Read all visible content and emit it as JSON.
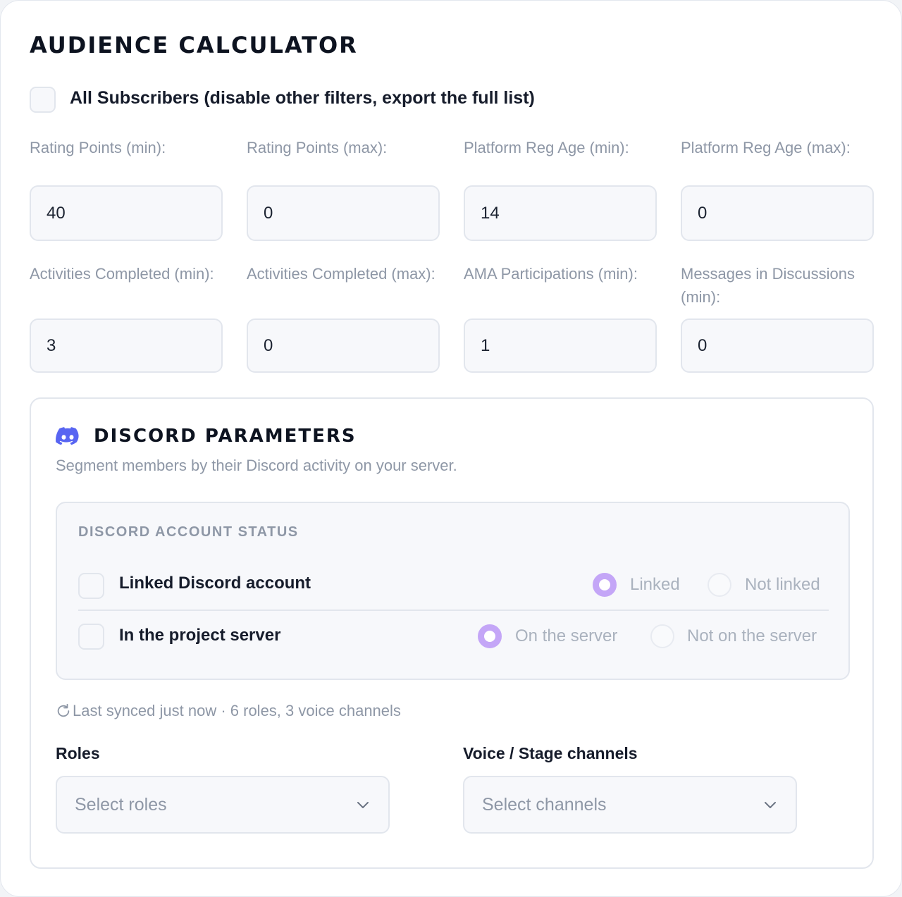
{
  "calculator": {
    "title": "AUDIENCE CALCULATOR",
    "all_subscribers_label": "All Subscribers (disable other filters, export the full list)",
    "fields": [
      {
        "label": "Rating Points (min):",
        "value": "40"
      },
      {
        "label": "Rating Points (max):",
        "value": "0"
      },
      {
        "label": "Platform Reg Age (min):",
        "value": "14"
      },
      {
        "label": "Platform Reg Age (max):",
        "value": "0"
      },
      {
        "label": "Activities Completed (min):",
        "value": "3"
      },
      {
        "label": "Activities Completed (max):",
        "value": "0"
      },
      {
        "label": "AMA Participations (min):",
        "value": "1"
      },
      {
        "label": "Messages in Discussions (min):",
        "value": "0"
      }
    ]
  },
  "discord": {
    "title": "DISCORD PARAMETERS",
    "subtitle": "Segment members by their Discord activity on your server.",
    "account_status": {
      "heading": "DISCORD ACCOUNT STATUS",
      "rows": [
        {
          "label": "Linked Discord account",
          "option_on": "Linked",
          "option_off": "Not linked"
        },
        {
          "label": "In the project server",
          "option_on": "On the server",
          "option_off": "Not on the server"
        }
      ]
    },
    "sync_text": "Last synced just now · 6 roles, 3 voice channels",
    "roles": {
      "label": "Roles",
      "placeholder": "Select roles"
    },
    "channels": {
      "label": "Voice / Stage channels",
      "placeholder": "Select channels"
    }
  },
  "colors": {
    "accent_radio": "#c4a6f7",
    "discord_brand": "#5865f2"
  },
  "icons": {
    "discord": "discord-icon",
    "sync": "refresh-icon",
    "dropdown": "chevron-down-icon"
  }
}
